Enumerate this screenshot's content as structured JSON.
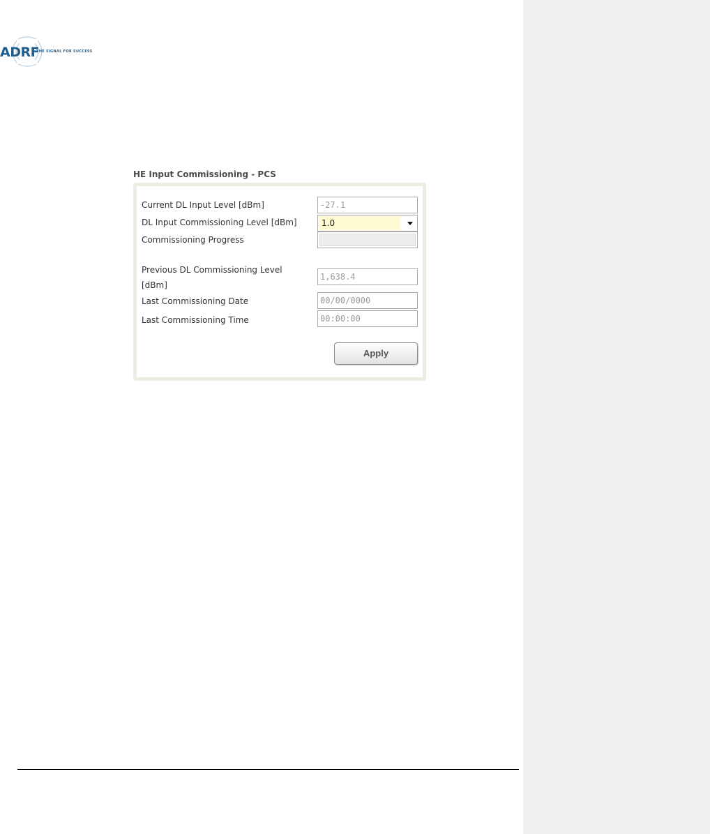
{
  "logo": {
    "brand": "ADRF",
    "tagline": "THE SIGNAL FOR SUCCESS",
    "brand_color": "#1f5d8c"
  },
  "panel": {
    "title": "HE Input Commissioning - PCS",
    "fields": {
      "current_dl_input_level": {
        "label": "Current DL Input Level [dBm]",
        "value": "-27.1"
      },
      "dl_input_commissioning_level": {
        "label": "DL Input Commissioning Level [dBm]",
        "selected": "1.0"
      },
      "commissioning_progress": {
        "label": "Commissioning Progress",
        "progress": 0
      },
      "previous_dl_commissioning_level": {
        "label": "Previous DL Commissioning Level [dBm]",
        "value": "1,638.4"
      },
      "last_commissioning_date": {
        "label": "Last Commissioning Date",
        "value": "00/00/0000"
      },
      "last_commissioning_time": {
        "label": "Last Commissioning Time",
        "value": "00:00:00"
      }
    },
    "apply_label": "Apply",
    "colors": {
      "panel_border": "#ecede2",
      "select_highlight": "#fffad2"
    }
  }
}
